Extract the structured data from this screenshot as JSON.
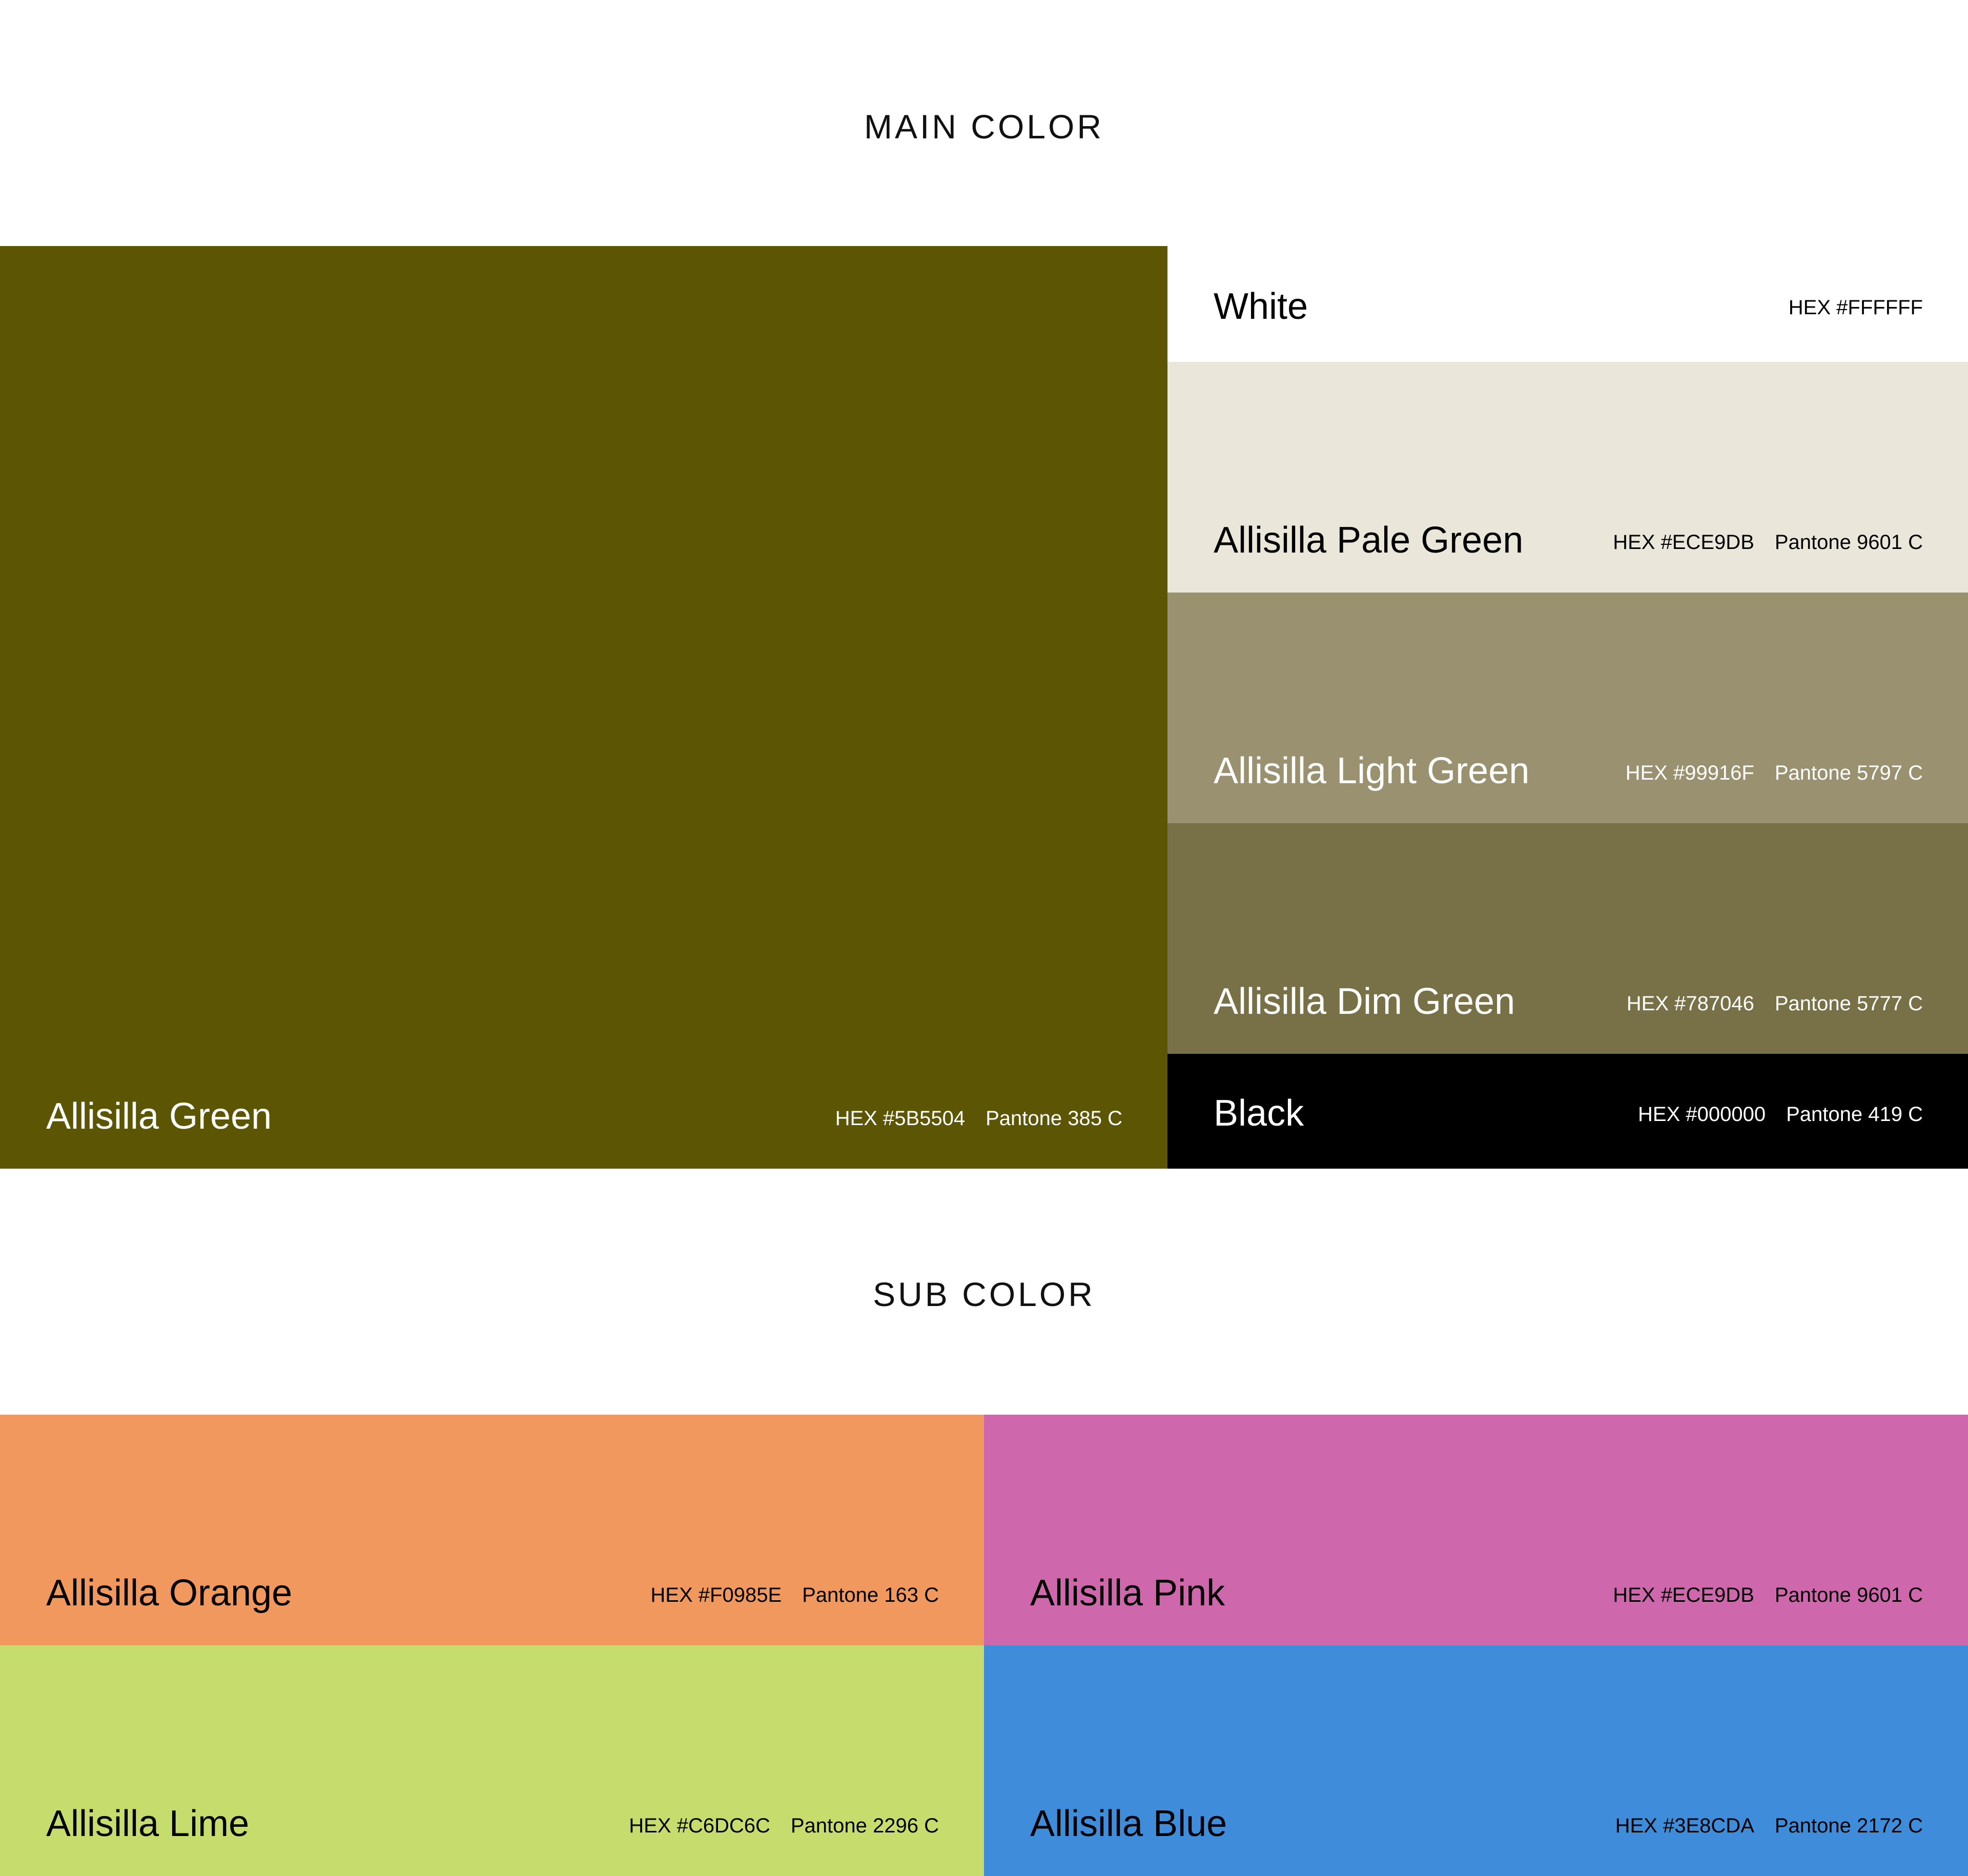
{
  "main": {
    "title": "MAIN COLOR",
    "swatches": [
      {
        "id": "green",
        "name": "Allisilla Green",
        "hex_label": "HEX #5B5504",
        "pantone": "Pantone 385 C",
        "color": "#5B5504",
        "text_color": "#ffffff"
      },
      {
        "id": "white",
        "name": "White",
        "hex_label": "HEX #FFFFFF",
        "pantone": "",
        "color": "#FFFFFF",
        "text_color": "#000000"
      },
      {
        "id": "pale",
        "name": "Allisilla Pale Green",
        "hex_label": "HEX #ECE9DB",
        "pantone": "Pantone 9601 C",
        "color": "#EAE7DA",
        "text_color": "#000000"
      },
      {
        "id": "light",
        "name": "Allisilla Light Green",
        "hex_label": "HEX #99916F",
        "pantone": "Pantone 5797 C",
        "color": "#99916F",
        "text_color": "#ffffff"
      },
      {
        "id": "dim",
        "name": "Allisilla Dim Green",
        "hex_label": "HEX #787046",
        "pantone": "Pantone 5777 C",
        "color": "#787046",
        "text_color": "#ffffff"
      },
      {
        "id": "black",
        "name": "Black",
        "hex_label": "HEX #000000",
        "pantone": "Pantone 419 C",
        "color": "#000000",
        "text_color": "#ffffff"
      }
    ]
  },
  "sub": {
    "title": "SUB COLOR",
    "swatches": [
      {
        "id": "orange",
        "name": "Allisilla Orange",
        "hex_label": "HEX #F0985E",
        "pantone": "Pantone 163 C",
        "color": "#F0985E",
        "text_color": "#000000"
      },
      {
        "id": "pink",
        "name": "Allisilla Pink",
        "hex_label": "HEX #ECE9DB",
        "pantone": "Pantone 9601 C",
        "color": "#CE67AB",
        "text_color": "#000000"
      },
      {
        "id": "lime",
        "name": "Allisilla Lime",
        "hex_label": "HEX #C6DC6C",
        "pantone": "Pantone 2296 C",
        "color": "#C6DC6C",
        "text_color": "#000000"
      },
      {
        "id": "blue",
        "name": "Allisilla Blue",
        "hex_label": "HEX #3E8CDA",
        "pantone": "Pantone 2172 C",
        "color": "#3E8CDA",
        "text_color": "#000000"
      }
    ]
  }
}
